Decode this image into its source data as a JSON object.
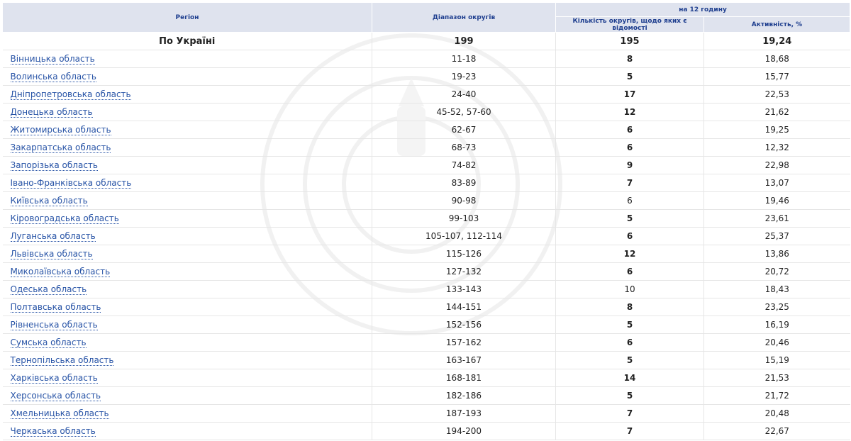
{
  "table": {
    "headers": {
      "region": "Регіон",
      "range": "Діапазон округів",
      "group": "на 12 годину",
      "count": "Кількість округів, щодо яких є відомості",
      "activity": "Активність, %"
    },
    "total": {
      "region": "По Україні",
      "range": "199",
      "count": "195",
      "activity": "19,24"
    },
    "rows": [
      {
        "region": "Вінницька область",
        "range": "11-18",
        "count": "8",
        "count_bold": true,
        "activity": "18,68"
      },
      {
        "region": "Волинська область",
        "range": "19-23",
        "count": "5",
        "count_bold": true,
        "activity": "15,77"
      },
      {
        "region": "Дніпропетровська область",
        "range": "24-40",
        "count": "17",
        "count_bold": true,
        "activity": "22,53"
      },
      {
        "region": "Донецька область",
        "range": "45-52, 57-60",
        "count": "12",
        "count_bold": true,
        "activity": "21,62"
      },
      {
        "region": "Житомирська область",
        "range": "62-67",
        "count": "6",
        "count_bold": true,
        "activity": "19,25"
      },
      {
        "region": "Закарпатська область",
        "range": "68-73",
        "count": "6",
        "count_bold": true,
        "activity": "12,32"
      },
      {
        "region": "Запорізька область",
        "range": "74-82",
        "count": "9",
        "count_bold": true,
        "activity": "22,98"
      },
      {
        "region": "Івано-Франківська область",
        "range": "83-89",
        "count": "7",
        "count_bold": true,
        "activity": "13,07"
      },
      {
        "region": "Київська область",
        "range": "90-98",
        "count": "6",
        "count_bold": false,
        "activity": "19,46"
      },
      {
        "region": "Кіровоградська область",
        "range": "99-103",
        "count": "5",
        "count_bold": true,
        "activity": "23,61"
      },
      {
        "region": "Луганська область",
        "range": "105-107, 112-114",
        "count": "6",
        "count_bold": true,
        "activity": "25,37"
      },
      {
        "region": "Львівська область",
        "range": "115-126",
        "count": "12",
        "count_bold": true,
        "activity": "13,86"
      },
      {
        "region": "Миколаївська область",
        "range": "127-132",
        "count": "6",
        "count_bold": true,
        "activity": "20,72"
      },
      {
        "region": "Одеська область",
        "range": "133-143",
        "count": "10",
        "count_bold": false,
        "activity": "18,43"
      },
      {
        "region": "Полтавська область",
        "range": "144-151",
        "count": "8",
        "count_bold": true,
        "activity": "23,25"
      },
      {
        "region": "Рівненська область",
        "range": "152-156",
        "count": "5",
        "count_bold": true,
        "activity": "16,19"
      },
      {
        "region": "Сумська область",
        "range": "157-162",
        "count": "6",
        "count_bold": true,
        "activity": "20,46"
      },
      {
        "region": "Тернопільська область",
        "range": "163-167",
        "count": "5",
        "count_bold": true,
        "activity": "15,19"
      },
      {
        "region": "Харківська область",
        "range": "168-181",
        "count": "14",
        "count_bold": true,
        "activity": "21,53"
      },
      {
        "region": "Херсонська область",
        "range": "182-186",
        "count": "5",
        "count_bold": true,
        "activity": "21,72"
      },
      {
        "region": "Хмельницька область",
        "range": "187-193",
        "count": "7",
        "count_bold": true,
        "activity": "20,48"
      },
      {
        "region": "Черкаська область",
        "range": "194-200",
        "count": "7",
        "count_bold": true,
        "activity": "22,67"
      }
    ]
  },
  "colors": {
    "header_bg": "#dfe3ee",
    "header_text": "#1f3f8f",
    "link": "#2753a6",
    "row_border": "#e6e6e6"
  },
  "watermark": {
    "icon": "cvk-seal-icon"
  }
}
